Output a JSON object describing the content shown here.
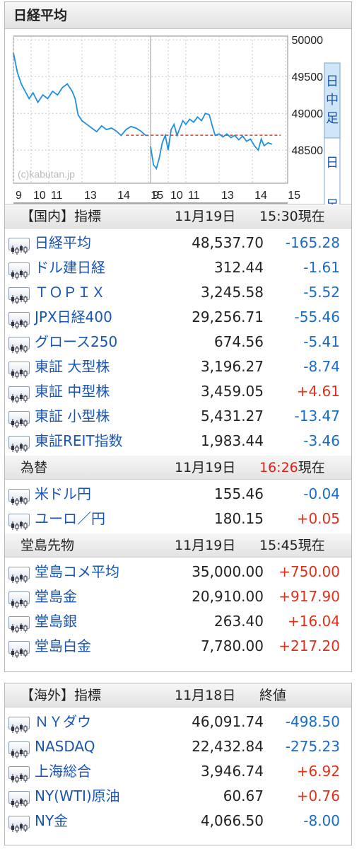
{
  "chart": {
    "title": "日経平均",
    "y_labels": [
      "50000",
      "49500",
      "49000",
      "48500"
    ],
    "x_labels": [
      "9",
      "10",
      "11",
      "13",
      "14",
      "15",
      "9",
      "10",
      "11",
      "13",
      "14",
      "15"
    ],
    "watermark": "(c)kabutan.jp",
    "side_top": [
      "日",
      "中",
      "足"
    ],
    "side_bottom": [
      "日",
      "足"
    ],
    "prev_close": 48702.98,
    "ylim": [
      48050,
      50050
    ],
    "colors": {
      "line": "#1f8fe0",
      "prev_close": "#e03a20",
      "grid": "#c8c8c8",
      "active_bg": "#cfe6f8"
    }
  },
  "chart_data": {
    "type": "line",
    "xlabel": "",
    "ylabel": "",
    "ylim": [
      48050,
      50050
    ],
    "series": [
      {
        "day": 1,
        "points": [
          [
            0,
            49820
          ],
          [
            4,
            49560
          ],
          [
            8,
            49400
          ],
          [
            12,
            49300
          ],
          [
            16,
            49200
          ],
          [
            20,
            49280
          ],
          [
            25,
            49150
          ],
          [
            30,
            49250
          ],
          [
            35,
            49200
          ],
          [
            40,
            49300
          ],
          [
            45,
            49250
          ],
          [
            50,
            49350
          ],
          [
            55,
            49400
          ],
          [
            60,
            49300
          ],
          [
            63,
            49200
          ],
          [
            66,
            48980
          ],
          [
            70,
            48900
          ],
          [
            75,
            48850
          ],
          [
            80,
            48800
          ],
          [
            85,
            48750
          ],
          [
            90,
            48830
          ],
          [
            95,
            48780
          ],
          [
            100,
            48800
          ],
          [
            105,
            48760
          ],
          [
            110,
            48700
          ],
          [
            115,
            48780
          ],
          [
            120,
            48820
          ],
          [
            125,
            48800
          ],
          [
            130,
            48760
          ],
          [
            135,
            48700
          ],
          [
            138,
            48700
          ]
        ]
      },
      {
        "day": 2,
        "points": [
          [
            0,
            48550
          ],
          [
            3,
            48300
          ],
          [
            6,
            48250
          ],
          [
            9,
            48400
          ],
          [
            12,
            48600
          ],
          [
            15,
            48700
          ],
          [
            18,
            48500
          ],
          [
            21,
            48780
          ],
          [
            24,
            48850
          ],
          [
            27,
            48700
          ],
          [
            30,
            48800
          ],
          [
            33,
            48900
          ],
          [
            36,
            48850
          ],
          [
            40,
            48920
          ],
          [
            44,
            48880
          ],
          [
            48,
            48950
          ],
          [
            52,
            48900
          ],
          [
            56,
            49000
          ],
          [
            60,
            48980
          ],
          [
            63,
            48830
          ],
          [
            66,
            48700
          ],
          [
            70,
            48720
          ],
          [
            74,
            48680
          ],
          [
            78,
            48720
          ],
          [
            82,
            48670
          ],
          [
            86,
            48700
          ],
          [
            90,
            48640
          ],
          [
            94,
            48690
          ],
          [
            98,
            48620
          ],
          [
            102,
            48650
          ],
          [
            106,
            48560
          ],
          [
            110,
            48500
          ],
          [
            113,
            48650
          ],
          [
            116,
            48560
          ],
          [
            120,
            48600
          ],
          [
            124,
            48580
          ]
        ]
      }
    ]
  },
  "sections": [
    {
      "head": {
        "name": "【国内】指標",
        "date": "11月19日",
        "time": "15:30現在"
      },
      "rows": [
        {
          "name": "日経平均",
          "value": "48,537.70",
          "change": "-165.28",
          "dir": "neg"
        },
        {
          "name": "ドル建日経",
          "value": "312.44",
          "change": "-1.61",
          "dir": "neg"
        },
        {
          "name": "ＴＯＰＩＸ",
          "value": "3,245.58",
          "change": "-5.52",
          "dir": "neg"
        },
        {
          "name": "JPX日経400",
          "value": "29,256.71",
          "change": "-55.46",
          "dir": "neg"
        },
        {
          "name": "グロース250",
          "value": "674.56",
          "change": "-5.41",
          "dir": "neg"
        },
        {
          "name": "東証 大型株",
          "value": "3,196.27",
          "change": "-8.74",
          "dir": "neg"
        },
        {
          "name": "東証 中型株",
          "value": "3,459.05",
          "change": "+4.61",
          "dir": "pos"
        },
        {
          "name": "東証 小型株",
          "value": "5,431.27",
          "change": "-13.47",
          "dir": "neg"
        },
        {
          "name": "東証REIT指数",
          "value": "1,983.44",
          "change": "-3.46",
          "dir": "neg"
        }
      ]
    },
    {
      "head": {
        "name": "為替",
        "date": "11月19日",
        "time_red": "16:26",
        "time_suffix": "現在"
      },
      "rows": [
        {
          "name": "米ドル円",
          "value": "155.46",
          "change": "-0.04",
          "dir": "neg"
        },
        {
          "name": "ユーロ／円",
          "value": "180.15",
          "change": "+0.05",
          "dir": "pos"
        }
      ]
    },
    {
      "head": {
        "name": "堂島先物",
        "date": "11月19日",
        "time": "15:45現在"
      },
      "rows": [
        {
          "name": "堂島コメ平均",
          "value": "35,000.00",
          "change": "+750.00",
          "dir": "pos"
        },
        {
          "name": "堂島金",
          "value": "20,910.00",
          "change": "+917.90",
          "dir": "pos"
        },
        {
          "name": "堂島銀",
          "value": "263.40",
          "change": "+16.04",
          "dir": "pos"
        },
        {
          "name": "堂島白金",
          "value": "7,780.00",
          "change": "+217.20",
          "dir": "pos"
        }
      ]
    },
    {
      "head": {
        "name": "【海外】指標",
        "date": "11月18日",
        "time": "終値"
      },
      "rows": [
        {
          "name": "ＮＹダウ",
          "value": "46,091.74",
          "change": "-498.50",
          "dir": "neg"
        },
        {
          "name": "NASDAQ",
          "value": "22,432.84",
          "change": "-275.23",
          "dir": "neg"
        },
        {
          "name": "上海総合",
          "value": "3,946.74",
          "change": "+6.92",
          "dir": "pos"
        },
        {
          "name": "NY(WTI)原油",
          "value": "60.67",
          "change": "+0.76",
          "dir": "pos"
        },
        {
          "name": "NY金",
          "value": "4,066.50",
          "change": "-8.00",
          "dir": "neg"
        }
      ]
    }
  ]
}
